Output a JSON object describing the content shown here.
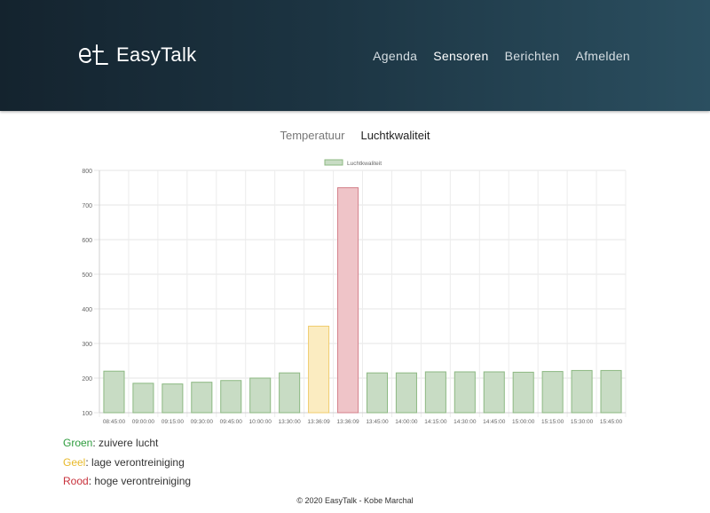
{
  "header": {
    "logo_text": "EasyTalk",
    "nav": [
      "Agenda",
      "Sensoren",
      "Berichten",
      "Afmelden"
    ],
    "active_nav": "Sensoren"
  },
  "tabs": {
    "items": [
      "Temperatuur",
      "Luchtkwaliteit"
    ],
    "active": "Luchtkwaliteit"
  },
  "chart_data": {
    "type": "bar",
    "title": "",
    "xlabel": "",
    "ylabel": "",
    "ylim": [
      100,
      800
    ],
    "yticks": [
      100,
      200,
      300,
      400,
      500,
      600,
      700,
      800
    ],
    "grid": true,
    "legend_position": "top",
    "categories": [
      "08:45:00",
      "09:00:00",
      "09:15:00",
      "09:30:00",
      "09:45:00",
      "10:00:00",
      "13:30:00",
      "13:36:09",
      "13:36:09",
      "13:45:00",
      "14:00:00",
      "14:15:00",
      "14:30:00",
      "14:45:00",
      "15:00:00",
      "15:15:00",
      "15:30:00",
      "15:45:00"
    ],
    "series": [
      {
        "name": "Luchtkwaliteit",
        "values": [
          220,
          185,
          183,
          188,
          193,
          200,
          215,
          350,
          750,
          215,
          215,
          218,
          218,
          218,
          217,
          219,
          222,
          222
        ],
        "colors": [
          "green",
          "green",
          "green",
          "green",
          "green",
          "green",
          "green",
          "yellow",
          "red",
          "green",
          "green",
          "green",
          "green",
          "green",
          "green",
          "green",
          "green",
          "green"
        ]
      }
    ],
    "palette": {
      "green": {
        "fill": "#c8dcc4",
        "stroke": "#8cb882"
      },
      "yellow": {
        "fill": "#fbecc1",
        "stroke": "#f0cc6e"
      },
      "red": {
        "fill": "#efc4c8",
        "stroke": "#d4828c"
      }
    }
  },
  "legend": {
    "lines": [
      {
        "label": "Groen",
        "text": ": zuivere lucht",
        "color": "#2e9c3e"
      },
      {
        "label": "Geel",
        "text": ": lage verontreiniging",
        "color": "#e8b92a"
      },
      {
        "label": "Rood",
        "text": ": hoge verontreiniging",
        "color": "#c8313b"
      }
    ]
  },
  "footer": {
    "text": "© 2020 EasyTalk - Kobe Marchal"
  }
}
